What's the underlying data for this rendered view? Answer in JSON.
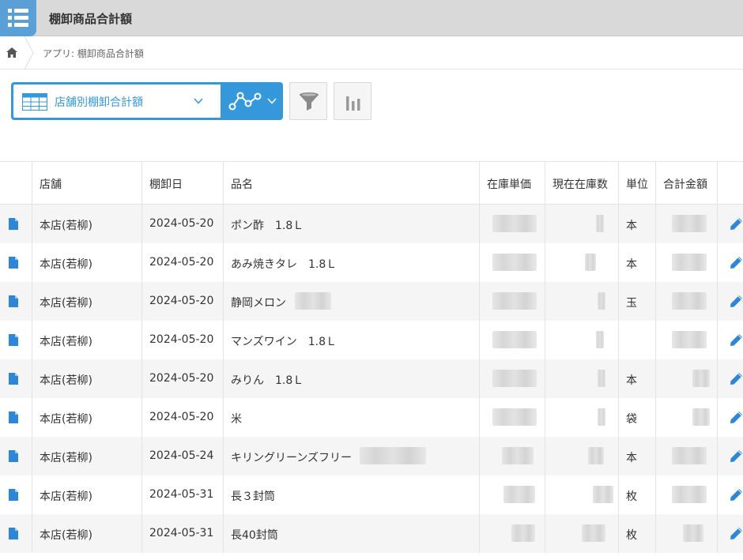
{
  "app": {
    "title": "棚卸商品合計額",
    "icon": "list-app-icon"
  },
  "breadcrumb": {
    "home_icon": "home-icon",
    "text": "アプリ: 棚卸商品合計額"
  },
  "toolbar": {
    "view_name": "店舗別棚卸合計額",
    "view_icon": "table-view-icon",
    "graph_icon": "line-graph-icon",
    "filter_icon": "filter-funnel-icon",
    "chart_icon": "bar-chart-icon",
    "accent_color": "#3498db"
  },
  "table": {
    "headers": [
      "店舗",
      "棚卸日",
      "品名",
      "在庫単価",
      "現在在庫数",
      "単位",
      "合計金額"
    ],
    "rows": [
      {
        "store": "本店(若柳)",
        "date": "2024-05-20",
        "item": "ポン酢　1.8Ｌ",
        "unit": "本"
      },
      {
        "store": "本店(若柳)",
        "date": "2024-05-20",
        "item": "あみ焼きタレ　1.8Ｌ",
        "unit": "本"
      },
      {
        "store": "本店(若柳)",
        "date": "2024-05-20",
        "item": "静岡メロン",
        "unit": "玉"
      },
      {
        "store": "本店(若柳)",
        "date": "2024-05-20",
        "item": "マンズワイン　1.8Ｌ",
        "unit": ""
      },
      {
        "store": "本店(若柳)",
        "date": "2024-05-20",
        "item": "みりん　1.8Ｌ",
        "unit": "本"
      },
      {
        "store": "本店(若柳)",
        "date": "2024-05-20",
        "item": "米",
        "unit": "袋"
      },
      {
        "store": "本店(若柳)",
        "date": "2024-05-24",
        "item": "キリングリーンズフリー",
        "unit": "本"
      },
      {
        "store": "本店(若柳)",
        "date": "2024-05-31",
        "item": "長３封筒",
        "unit": "枚"
      },
      {
        "store": "本店(若柳)",
        "date": "2024-05-31",
        "item": "長40封筒",
        "unit": "枚"
      }
    ]
  }
}
